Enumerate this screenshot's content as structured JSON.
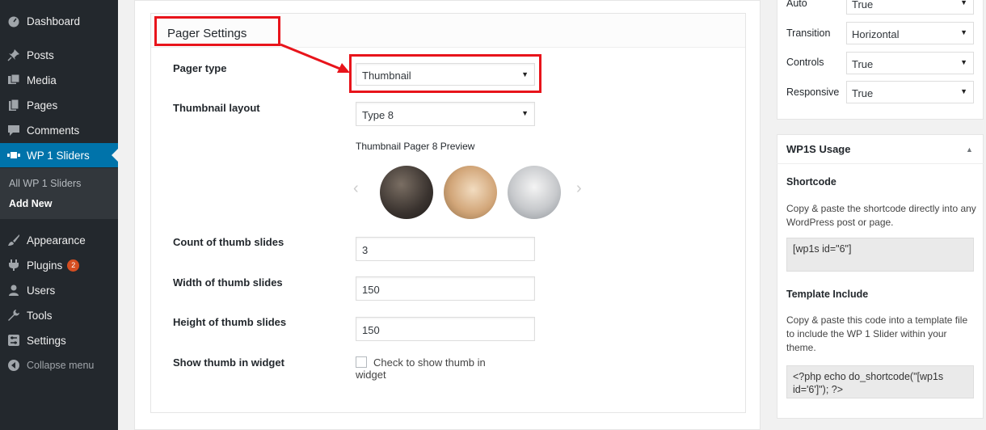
{
  "sidebar": {
    "items": [
      {
        "label": "Dashboard",
        "icon": "dashboard-icon"
      },
      {
        "label": "Posts",
        "icon": "pin-icon"
      },
      {
        "label": "Media",
        "icon": "media-icon"
      },
      {
        "label": "Pages",
        "icon": "pages-icon"
      },
      {
        "label": "Comments",
        "icon": "comment-icon"
      },
      {
        "label": "WP 1 Sliders",
        "icon": "slides-icon"
      },
      {
        "label": "Appearance",
        "icon": "brush-icon"
      },
      {
        "label": "Plugins",
        "icon": "plugin-icon",
        "badge": "2"
      },
      {
        "label": "Users",
        "icon": "user-icon"
      },
      {
        "label": "Tools",
        "icon": "wrench-icon"
      },
      {
        "label": "Settings",
        "icon": "settings-icon"
      }
    ],
    "submenu": [
      "All WP 1 Sliders",
      "Add New"
    ],
    "collapse": "Collapse menu"
  },
  "pager": {
    "title": "Pager Settings",
    "pager_type_label": "Pager type",
    "pager_type_value": "Thumbnail",
    "layout_label": "Thumbnail layout",
    "layout_value": "Type 8",
    "preview_title": "Thumbnail Pager 8 Preview",
    "count_label": "Count of thumb slides",
    "count_value": "3",
    "width_label": "Width of thumb slides",
    "width_value": "150",
    "height_label": "Height of thumb slides",
    "height_value": "150",
    "widget_label": "Show thumb in widget",
    "widget_check_label": "Check to show thumb in widget"
  },
  "settings": {
    "auto_label": "Auto",
    "auto_value": "True",
    "transition_label": "Transition",
    "transition_value": "Horizontal",
    "controls_label": "Controls",
    "controls_value": "True",
    "responsive_label": "Responsive",
    "responsive_value": "True"
  },
  "usage": {
    "title": "WP1S Usage",
    "shortcode_title": "Shortcode",
    "shortcode_text": "Copy & paste the shortcode directly into any WordPress post or page.",
    "shortcode_code": "[wp1s id=\"6\"]",
    "template_title": "Template Include",
    "template_text": "Copy & paste this code into a template file to include the WP 1 Slider within your theme.",
    "template_code": "<?php echo do_shortcode(\"[wp1s id='6']\"); ?>"
  },
  "colors": {
    "accent": "#0073aa",
    "highlight": "#e8141b",
    "sidebar": "#23282d"
  }
}
